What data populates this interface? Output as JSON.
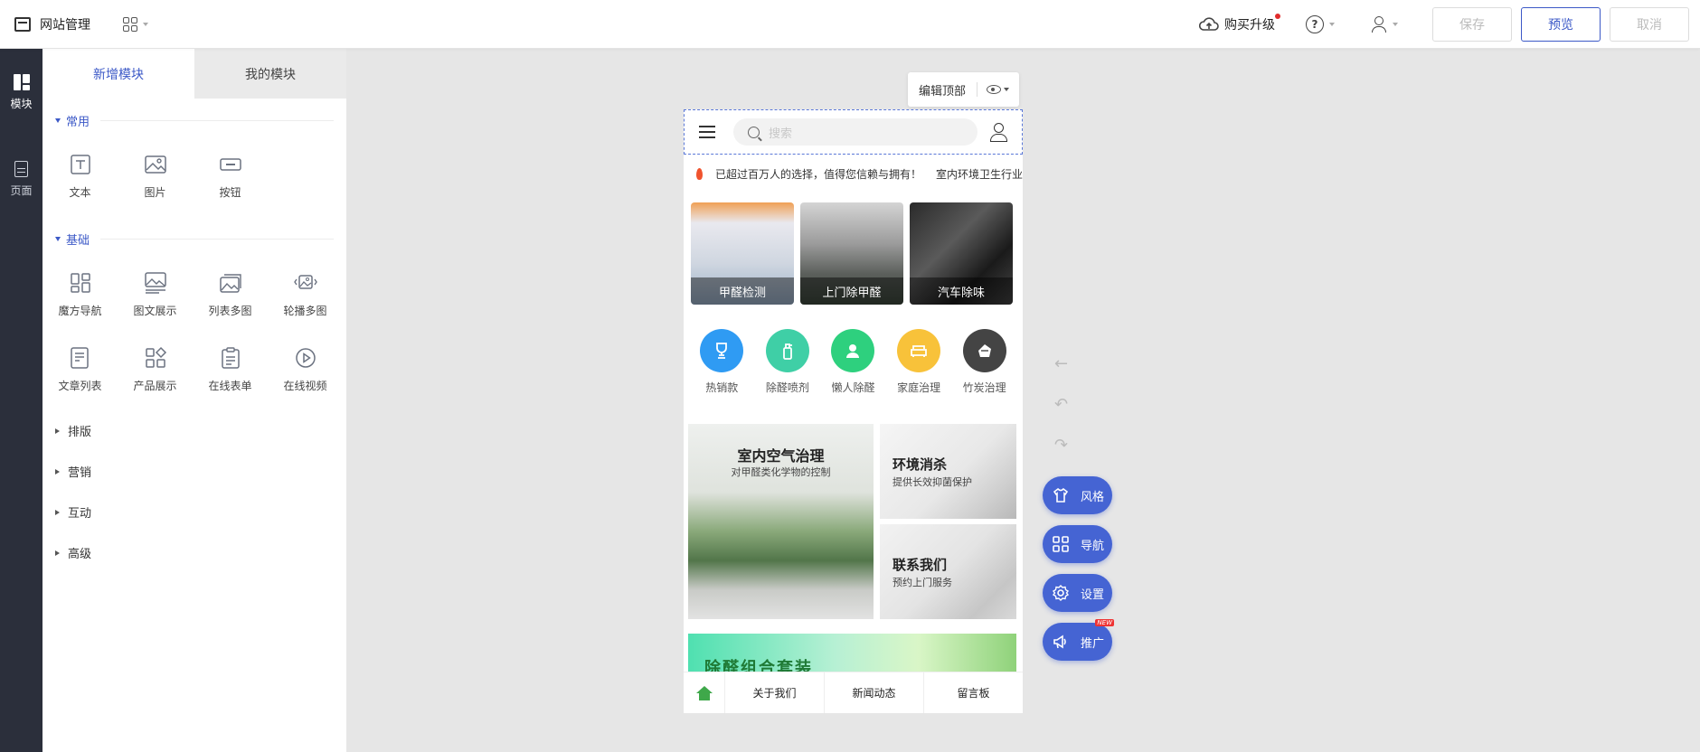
{
  "header": {
    "title": "网站管理",
    "upgrade_label": "购买升级",
    "help_symbol": "?",
    "buttons": {
      "save": "保存",
      "preview": "预览",
      "cancel": "取消"
    },
    "accent_color": "#3c59c7"
  },
  "rail": {
    "items": [
      {
        "label": "模块",
        "icon": "modules-icon",
        "active": true
      },
      {
        "label": "页面",
        "icon": "page-icon",
        "active": false
      }
    ]
  },
  "panel": {
    "tabs": [
      {
        "label": "新增模块",
        "active": true
      },
      {
        "label": "我的模块",
        "active": false
      }
    ],
    "groups": {
      "common": {
        "title": "常用",
        "items": [
          {
            "label": "文本",
            "icon": "text-icon"
          },
          {
            "label": "图片",
            "icon": "image-icon"
          },
          {
            "label": "按钮",
            "icon": "button-icon"
          }
        ]
      },
      "basic": {
        "title": "基础",
        "items": [
          {
            "label": "魔方导航",
            "icon": "cube-nav-icon"
          },
          {
            "label": "图文展示",
            "icon": "image-text-icon"
          },
          {
            "label": "列表多图",
            "icon": "list-images-icon"
          },
          {
            "label": "轮播多图",
            "icon": "carousel-icon"
          },
          {
            "label": "文章列表",
            "icon": "article-list-icon"
          },
          {
            "label": "产品展示",
            "icon": "product-icon"
          },
          {
            "label": "在线表单",
            "icon": "form-icon"
          },
          {
            "label": "在线视频",
            "icon": "video-icon"
          }
        ]
      },
      "collapsed": [
        "排版",
        "营销",
        "互动",
        "高级"
      ]
    }
  },
  "canvas": {
    "edit_top_label": "编辑顶部",
    "phone": {
      "search_placeholder": "搜索",
      "notice": [
        "已超过百万人的选择，值得您信赖与拥有！",
        "室内环境卫生行业"
      ],
      "categories": [
        "甲醛检测",
        "上门除甲醛",
        "汽车除味"
      ],
      "icons": [
        {
          "label": "热销款",
          "color": "#2f9bf3",
          "icon": "trophy-icon"
        },
        {
          "label": "除醛喷剂",
          "color": "#3fcfa6",
          "icon": "spray-icon"
        },
        {
          "label": "懒人除醛",
          "color": "#2ed07e",
          "icon": "person-icon"
        },
        {
          "label": "家庭治理",
          "color": "#f8c23a",
          "icon": "sofa-icon"
        },
        {
          "label": "竹炭治理",
          "color": "#444444",
          "icon": "charcoal-icon"
        }
      ],
      "banners": {
        "big": {
          "title": "室内空气治理",
          "subtitle": "对甲醛类化学物的控制"
        },
        "a": {
          "title": "环境消杀",
          "subtitle": "提供长效抑菌保护"
        },
        "b": {
          "title": "联系我们",
          "subtitle": "预约上门服务"
        }
      },
      "combo_title": "除醛组合套装",
      "bottom_nav": [
        "关于我们",
        "新闻动态",
        "留言板"
      ]
    },
    "history": [
      "←",
      "↶",
      "↷"
    ],
    "float_buttons": [
      {
        "label": "风格",
        "icon": "shirt-icon"
      },
      {
        "label": "导航",
        "icon": "grid-icon"
      },
      {
        "label": "设置",
        "icon": "gear-icon"
      },
      {
        "label": "推广",
        "icon": "megaphone-icon",
        "badge": "NEW"
      }
    ]
  }
}
